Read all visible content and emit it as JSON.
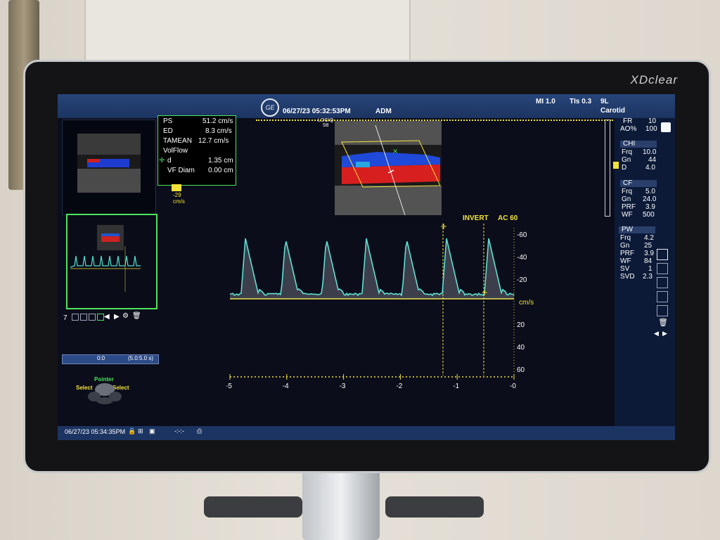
{
  "device": {
    "brand": "XDclear"
  },
  "header": {
    "datetime": "06/27/23 05:32:53PM",
    "operator": "ADM",
    "mi": "MI 1.0",
    "tis": "TIs 0.3",
    "probe": "9L",
    "preset": "Carotid",
    "probe_model": "LOGIQ\nS8"
  },
  "measurements": {
    "rows": [
      {
        "label": "PS",
        "value": "51.2 cm/s"
      },
      {
        "label": "ED",
        "value": "8.3 cm/s"
      },
      {
        "label": "TAMEAN",
        "value": "12.7 cm/s"
      },
      {
        "label": "VolFlow",
        "value": ""
      },
      {
        "label": "d",
        "value": "1.35 cm"
      },
      {
        "label": "VF Diam",
        "value": "0.00 cm"
      }
    ]
  },
  "color_scale": {
    "value": "-29",
    "unit": "cm/s"
  },
  "image_params": [
    {
      "label": "FR",
      "value": "10"
    },
    {
      "label": "AO%",
      "value": "100"
    }
  ],
  "chi": {
    "title": "CHI",
    "rows": [
      {
        "label": "Frq",
        "value": "10.0"
      },
      {
        "label": "Gn",
        "value": "44"
      },
      {
        "label": "D",
        "value": "4.0"
      }
    ]
  },
  "cf": {
    "title": "CF",
    "rows": [
      {
        "label": "Frq",
        "value": "5.0"
      },
      {
        "label": "Gn",
        "value": "24.0"
      },
      {
        "label": "PRF",
        "value": "3.9"
      },
      {
        "label": "WF",
        "value": "500"
      }
    ]
  },
  "pw": {
    "title": "PW",
    "rows": [
      {
        "label": "Frq",
        "value": "4.2"
      },
      {
        "label": "Gn",
        "value": "25"
      },
      {
        "label": "PRF",
        "value": "3.9"
      },
      {
        "label": "WF",
        "value": "84"
      },
      {
        "label": "SV",
        "value": "1"
      },
      {
        "label": "SVD",
        "value": "2.3"
      }
    ]
  },
  "doppler": {
    "invert": "INVERT",
    "ac": "AC 60",
    "unit": "cm/s",
    "y_ticks": [
      "-60",
      "-40",
      "-20",
      "20",
      "40",
      "60"
    ],
    "x_ticks": [
      "-5",
      "-4",
      "-3",
      "-2",
      "-1",
      "-0"
    ]
  },
  "cine": {
    "frame": "7",
    "position": "0:0",
    "range": "(5.0:5.0 s)"
  },
  "trackball": {
    "title": "Pointer",
    "left": "Select",
    "right": "Select"
  },
  "footer": {
    "datetime": "06/27/23 05:34:35PM"
  },
  "colors": {
    "waveform": "#4ee0d2",
    "accent": "#f2e33a",
    "header": "#27457a"
  }
}
